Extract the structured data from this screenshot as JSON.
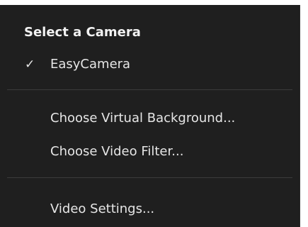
{
  "menu": {
    "header": "Select a Camera",
    "cameras": [
      {
        "label": "EasyCamera",
        "checked": true,
        "check_icon": "checkmark-icon"
      }
    ],
    "items": [
      {
        "label": "Choose Virtual Background..."
      },
      {
        "label": "Choose Video Filter..."
      },
      {
        "label": "Video Settings..."
      }
    ],
    "colors": {
      "background": "#1f1f1f",
      "text": "#e6e6e6",
      "divider": "#3c3c3c"
    }
  }
}
